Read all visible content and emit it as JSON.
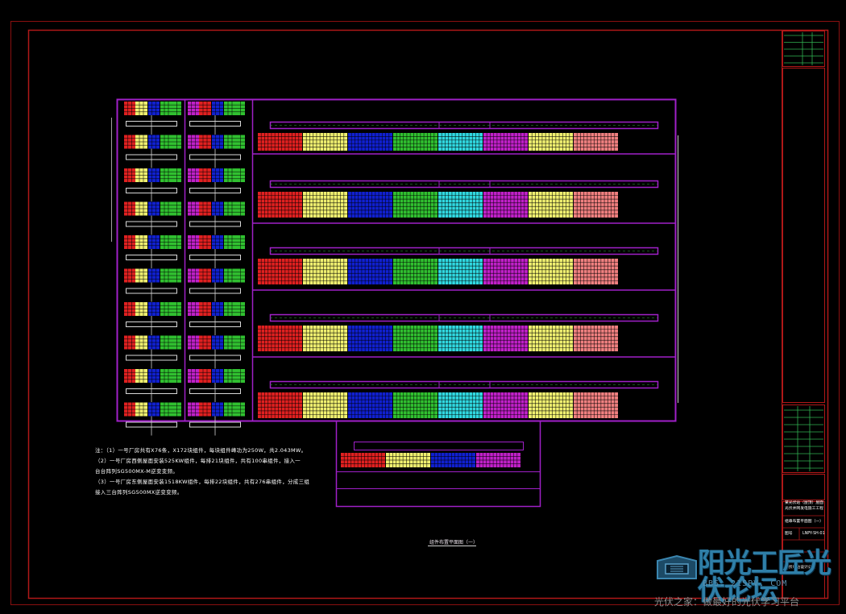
{
  "drawing": {
    "notes": [
      "注：（1）一号厂房共有X76条，X172块组件，每块组件峰功为250W，共2.043MW。",
      "（2）一号厂房西侧屋面安装525KW组件，每排21块组件，共有100串组件，接入一",
      "台台阵列SG500MX-M逆变变频。",
      "（3）一号厂房东侧屋面安装1518KW组件，每排22块组件，共有276串组件，分成三组",
      "接入三台阵列SG500MX逆变变频。"
    ],
    "caption": "组件布置平面图（一）"
  },
  "title_block": {
    "project_line1": "某光伏站（屋顶）屋面",
    "project_line2": "光伏并网发电施工工程",
    "sheet_title": "组串布置平面图（一）",
    "drawing_no_label": "图号",
    "drawing_no": "LNPY-SH-01",
    "company": "光伏电站设计公司"
  },
  "watermark": {
    "brand": "阳光工匠光伏论坛",
    "url": "BBS. 21SPV. COM",
    "slogan": "光伏之家：做最好的光伏学习平台"
  },
  "colors": {
    "frame": "#a01818",
    "outline": "#a020c8",
    "grid_green": "#30b050",
    "module_palette": [
      "#e02020",
      "#f0f070",
      "#1020d0",
      "#30c030",
      "#30d8e0",
      "#c020c8",
      "#f0f070",
      "#f08080"
    ]
  }
}
